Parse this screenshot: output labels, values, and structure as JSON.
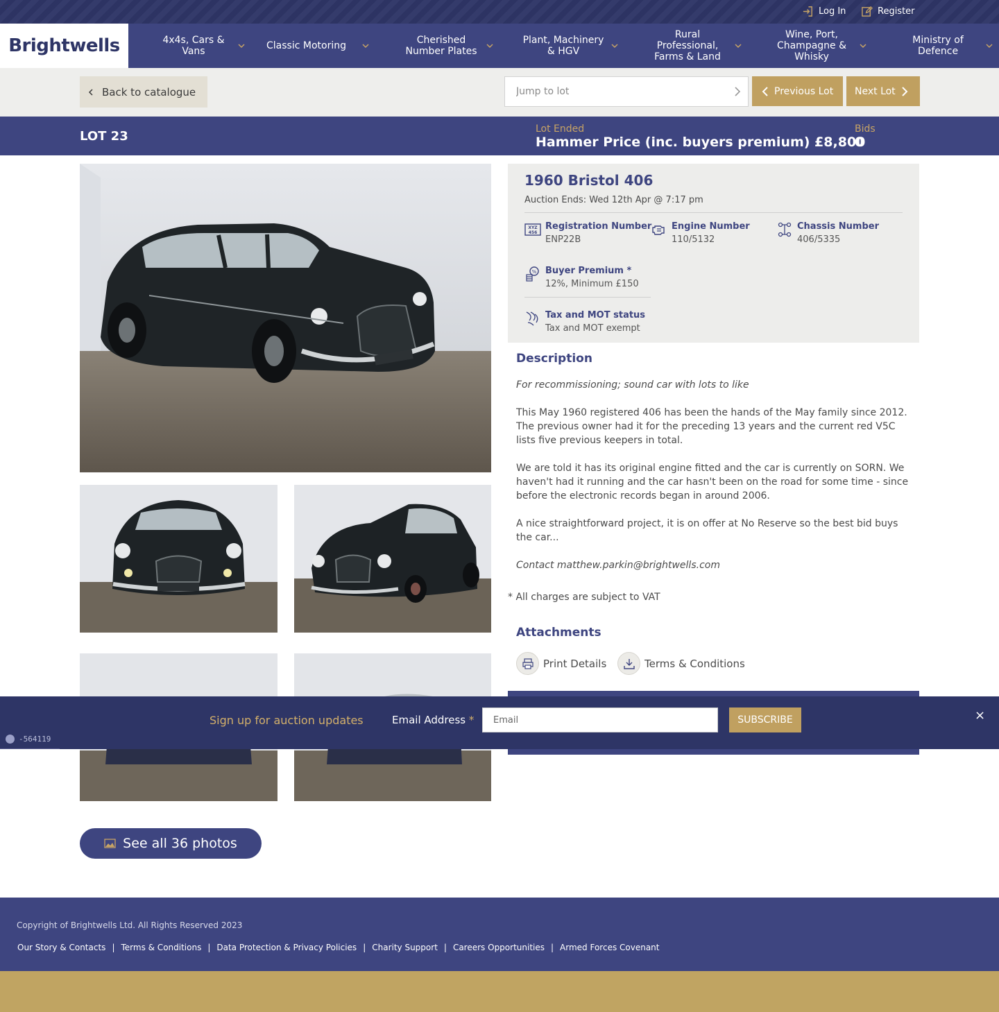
{
  "topbar": {
    "login_label": "Log In",
    "register_label": "Register"
  },
  "brand": {
    "logo_text": "Brightwells"
  },
  "nav": {
    "items": [
      {
        "label": "4x4s, Cars &\nVans"
      },
      {
        "label": "Classic Motoring"
      },
      {
        "label": "Cherished\nNumber Plates"
      },
      {
        "label": "Plant, Machinery\n& HGV"
      },
      {
        "label": "Rural\nProfessional,\nFarms & Land"
      },
      {
        "label": "Wine, Port,\nChampagne &\nWhisky"
      },
      {
        "label": "Ministry of\nDefence"
      }
    ]
  },
  "subbar": {
    "back_label": "Back to catalogue",
    "jump_placeholder": "Jump to lot",
    "prev_label": "Previous Lot",
    "next_label": "Next Lot"
  },
  "lot": {
    "number_label": "LOT 23",
    "status_label": "Lot Ended",
    "hammer_price": "Hammer Price (inc. buyers premium) £8,800",
    "bids_label": "Bids",
    "bids_value": "0"
  },
  "vehicle": {
    "title": "1960 Bristol 406",
    "auction_ends": "Auction Ends: Wed 12th Apr @ 7:17 pm",
    "specs": {
      "registration": {
        "label": "Registration Number",
        "value": "ENP22B"
      },
      "engine": {
        "label": "Engine Number",
        "value": "110/5132"
      },
      "chassis": {
        "label": "Chassis Number",
        "value": "406/5335"
      },
      "premium": {
        "label": "Buyer Premium *",
        "value": "12%, Minimum £150"
      },
      "tax": {
        "label": "Tax and MOT status",
        "value": "Tax and MOT exempt"
      }
    }
  },
  "description": {
    "heading": "Description",
    "paragraphs": [
      "For recommissioning; sound car with lots to like",
      "This May 1960 registered 406 has been the hands of the May family since 2012. The previous owner had it for the preceding 13 years and the current red V5C lists five previous keepers in total.",
      "We are told it has its original engine fitted and the car is currently on SORN. We haven't had it running and the car hasn't been on the road for some time - since before the electronic records began in around 2006.",
      "A nice straightforward project, it is on offer at No Reserve so the best bid buys the car...",
      "Contact matthew.parkin@brightwells.com"
    ],
    "vat_note": "* All charges are subject to VAT"
  },
  "attachments": {
    "heading": "Attachments",
    "print_label": "Print Details",
    "terms_label": "Terms & Conditions"
  },
  "gallery": {
    "see_all_label": "See all 36 photos"
  },
  "signup": {
    "title": "Sign up for auction updates",
    "email_label": "Email Address",
    "required_mark": "*",
    "email_placeholder": "Email",
    "button_label": "SUBSCRIBE",
    "close_glyph": "×"
  },
  "debug_badge": {
    "text": "-564119"
  },
  "footer": {
    "copyright": "Copyright of Brightwells Ltd. All Rights Reserved 2023",
    "links": [
      "Our Story & Contacts",
      "Terms & Conditions",
      "Data Protection & Privacy Policies",
      "Charity Support",
      "Careers Opportunities",
      "Armed Forces Covenant"
    ],
    "separator": "|"
  },
  "colors": {
    "navy": "#3e4580",
    "navy_dark": "#2e3566",
    "gold": "#c0a060",
    "panel_grey": "#ededeb"
  }
}
